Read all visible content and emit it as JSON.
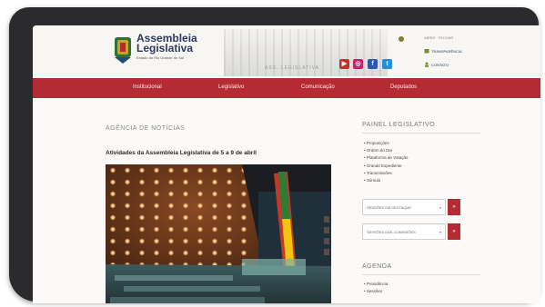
{
  "header": {
    "logo_title_line1": "Assembleia",
    "logo_title_line2": "Legislativa",
    "logo_subtitle": "Estado do Rio Grande do Sul",
    "skyline_caption": "ASS. LEGISLATIVA",
    "top_right_text": "ABRIR · FECHAR",
    "links": [
      {
        "label": "TRANSPARÊNCIA",
        "icon": "building-icon"
      },
      {
        "label": "CONTATO",
        "icon": "person-icon"
      }
    ],
    "social": [
      {
        "name": "youtube-icon",
        "glyph": "▶"
      },
      {
        "name": "instagram-icon",
        "glyph": "◎"
      },
      {
        "name": "facebook-icon",
        "glyph": "f"
      },
      {
        "name": "twitter-icon",
        "glyph": "t"
      }
    ]
  },
  "nav": {
    "items": [
      "Institucional",
      "Legislativo",
      "Comunicação",
      "Deputados"
    ]
  },
  "main": {
    "section_title": "AGÊNCIA DE NOTÍCIAS",
    "headline": "Atividades da Assembleia Legislativa de 5 a 9 de abril"
  },
  "sidebar": {
    "panel_title": "PAINEL LEGISLATIVO",
    "panel_items": [
      "Proposições",
      "Ordem do Dia",
      "Plataforma de Votação",
      "Grande Expediente",
      "Transmissões",
      "Súmula"
    ],
    "select_1": "SESSÕES EM DESTAQUE",
    "select_2": "SESSÕES DAS COMISSÕES",
    "go_label": "»",
    "agenda_title": "AGENDA",
    "agenda_items": [
      "Presidência",
      "Sessões"
    ]
  },
  "colors": {
    "brand_red": "#b52b34",
    "brand_navy": "#2c3b5e"
  }
}
